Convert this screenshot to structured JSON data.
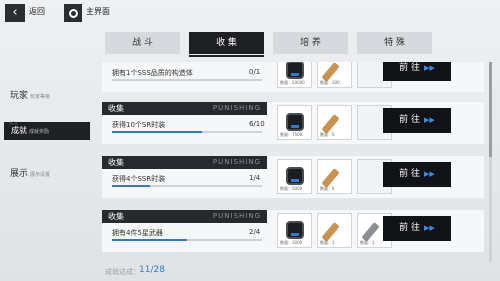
{
  "topbar": {
    "back_icon": "chevron-left-icon",
    "back_label": "返回",
    "home_icon": "circle-icon",
    "home_label": "主界面"
  },
  "tabs": [
    {
      "label": "战 斗",
      "active": false
    },
    {
      "label": "收 集",
      "active": true
    },
    {
      "label": "培 养",
      "active": false
    },
    {
      "label": "特 殊",
      "active": false
    }
  ],
  "nav": {
    "items": [
      {
        "label": "玩家",
        "sub": "玩家等级"
      },
      {
        "label": "成就",
        "sub": "成就奖励",
        "pre": "ACH",
        "active": true
      },
      {
        "label": "展示",
        "sub": "展示设置"
      }
    ]
  },
  "cards": [
    {
      "title": "",
      "desc": "拥有1个SSS品质的构造体",
      "count": "0/1",
      "progress": 0.0,
      "rewards": [
        {
          "icon": "chip-icon",
          "qty": "数量：20000"
        },
        {
          "icon": "cylinder-icon",
          "qty": "数量：200"
        }
      ],
      "button": "前 往"
    },
    {
      "title": "收集",
      "watermark": "PUNISHING",
      "desc": "获得10个SR时装",
      "count": "6/10",
      "progress": 0.6,
      "rewards": [
        {
          "icon": "chip-icon",
          "qty": "数量：7500"
        },
        {
          "icon": "cylinder-icon",
          "qty": "数量：6"
        }
      ],
      "button": "前 往"
    },
    {
      "title": "收集",
      "watermark": "PUNISHING",
      "desc": "获得4个SSR时装",
      "count": "1/4",
      "progress": 0.25,
      "rewards": [
        {
          "icon": "chip-icon",
          "qty": "数量：5000"
        },
        {
          "icon": "cylinder-icon",
          "qty": "数量：6"
        }
      ],
      "button": "前 往"
    },
    {
      "title": "收集",
      "watermark": "PUNISHING",
      "desc": "拥有4件5星武器",
      "count": "2/4",
      "progress": 0.5,
      "rewards": [
        {
          "icon": "chip-icon",
          "qty": "数量：3000"
        },
        {
          "icon": "cylinder-icon",
          "qty": "数量：1"
        },
        {
          "icon": "cylinder-icon",
          "qty": "数量：1"
        }
      ],
      "button": "前 往"
    }
  ],
  "footer": {
    "label": "成就达成：",
    "value": "11/28"
  },
  "colors": {
    "accent": "#2b7bd6",
    "dark": "#1e2023"
  }
}
